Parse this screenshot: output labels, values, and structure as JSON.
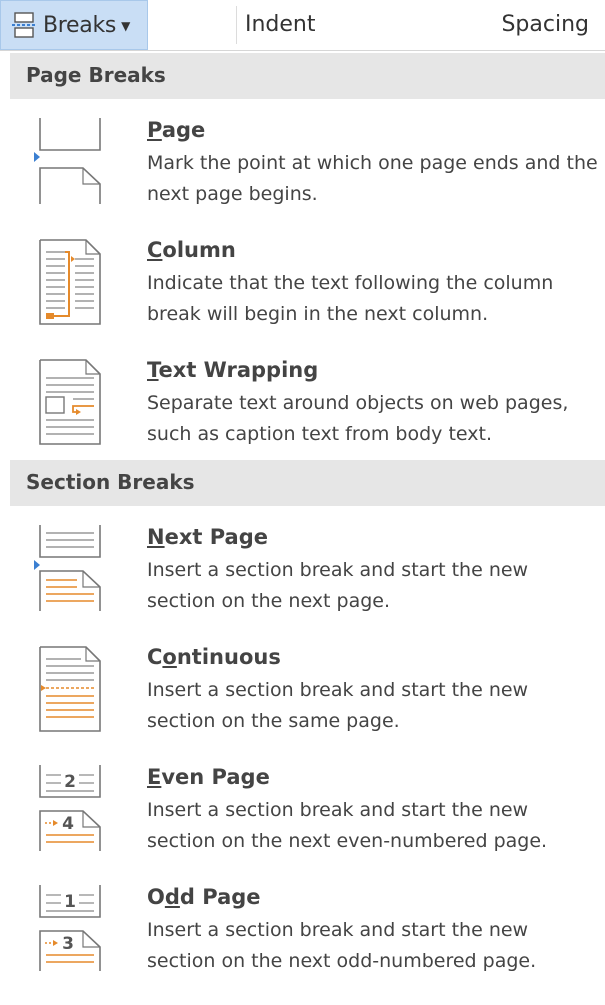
{
  "toolbar": {
    "breaks_label": "Breaks",
    "indent_label": "Indent",
    "spacing_label": "Spacing"
  },
  "page_breaks": {
    "header": "Page Breaks",
    "items": [
      {
        "title_pre": "",
        "title_key": "P",
        "title_post": "age",
        "description": "Mark the point at which one page ends and the next page begins.",
        "icon": "page-break-icon"
      },
      {
        "title_pre": "",
        "title_key": "C",
        "title_post": "olumn",
        "description": "Indicate that the text following the column break will begin in the next column.",
        "icon": "column-break-icon"
      },
      {
        "title_pre": "",
        "title_key": "T",
        "title_post": "ext Wrapping",
        "description": "Separate text around objects on web pages, such as caption text from body text.",
        "icon": "text-wrapping-icon"
      }
    ]
  },
  "section_breaks": {
    "header": "Section Breaks",
    "items": [
      {
        "title_pre": "",
        "title_key": "N",
        "title_post": "ext Page",
        "description": "Insert a section break and start the new section on the next page.",
        "icon": "next-page-icon"
      },
      {
        "title_pre": "C",
        "title_key": "o",
        "title_post": "ntinuous",
        "description": "Insert a section break and start the new section on the same page.",
        "icon": "continuous-icon"
      },
      {
        "title_pre": "",
        "title_key": "E",
        "title_post": "ven Page",
        "description": "Insert a section break and start the new section on the next even-numbered page.",
        "icon": "even-page-icon",
        "top_number": "2",
        "bottom_number": "4"
      },
      {
        "title_pre": "O",
        "title_key": "d",
        "title_post": "d Page",
        "description": "Insert a section break and start the new section on the next odd-numbered page.",
        "icon": "odd-page-icon",
        "top_number": "1",
        "bottom_number": "3"
      }
    ]
  },
  "colors": {
    "highlight": "#c9def5",
    "section_header_bg": "#e6e6e6",
    "marker": "#3b7fd1",
    "accent_orange": "#e58a2b"
  }
}
